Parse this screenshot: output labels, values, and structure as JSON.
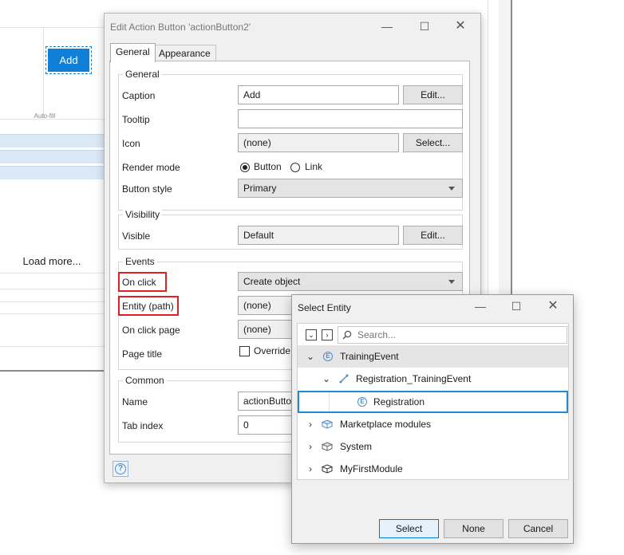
{
  "background": {
    "add_button": "Add",
    "auto_fill": "Auto-fill",
    "load_more": "Load more..."
  },
  "dialog": {
    "title": "Edit Action Button 'actionButton2'",
    "tabs": [
      "General",
      "Appearance"
    ],
    "general_group": "General",
    "caption_label": "Caption",
    "caption_value": "Add",
    "edit_label": "Edit...",
    "tooltip_label": "Tooltip",
    "tooltip_value": "",
    "icon_label": "Icon",
    "icon_value": "(none)",
    "select_label": "Select...",
    "render_mode_label": "Render mode",
    "render_options": [
      "Button",
      "Link"
    ],
    "render_selected": "Button",
    "button_style_label": "Button style",
    "button_style_value": "Primary",
    "visibility_group": "Visibility",
    "visible_label": "Visible",
    "visible_value": "Default",
    "events_group": "Events",
    "on_click_label": "On click",
    "on_click_value": "Create object",
    "entity_path_label": "Entity (path)",
    "entity_path_value": "(none)",
    "on_click_page_label": "On click page",
    "on_click_page_value": "(none)",
    "page_title_label": "Page title",
    "override_label": "Override",
    "override_checked": false,
    "common_group": "Common",
    "name_label": "Name",
    "name_value": "actionButto",
    "tab_index_label": "Tab index",
    "tab_index_value": "0",
    "help_icon": "question-icon"
  },
  "select_entity": {
    "title": "Select Entity",
    "search_placeholder": "Search...",
    "tree": [
      {
        "label": "TrainingEvent",
        "icon": "entity-icon",
        "expanded": true,
        "level": 0
      },
      {
        "label": "Registration_TrainingEvent",
        "icon": "association-icon",
        "expanded": true,
        "level": 1
      },
      {
        "label": "Registration",
        "icon": "entity-icon",
        "selected": true,
        "level": 2
      },
      {
        "label": "Marketplace modules",
        "icon": "module-icon",
        "expanded": false,
        "level": 0
      },
      {
        "label": "System",
        "icon": "module-icon",
        "expanded": false,
        "level": 0
      },
      {
        "label": "MyFirstModule",
        "icon": "module-icon",
        "expanded": false,
        "level": 0
      }
    ],
    "buttons": {
      "select": "Select",
      "none": "None",
      "cancel": "Cancel"
    }
  },
  "colors": {
    "accent": "#0f7fd8",
    "highlight_red": "#e02020",
    "selection_blue": "#1f8ad8"
  }
}
